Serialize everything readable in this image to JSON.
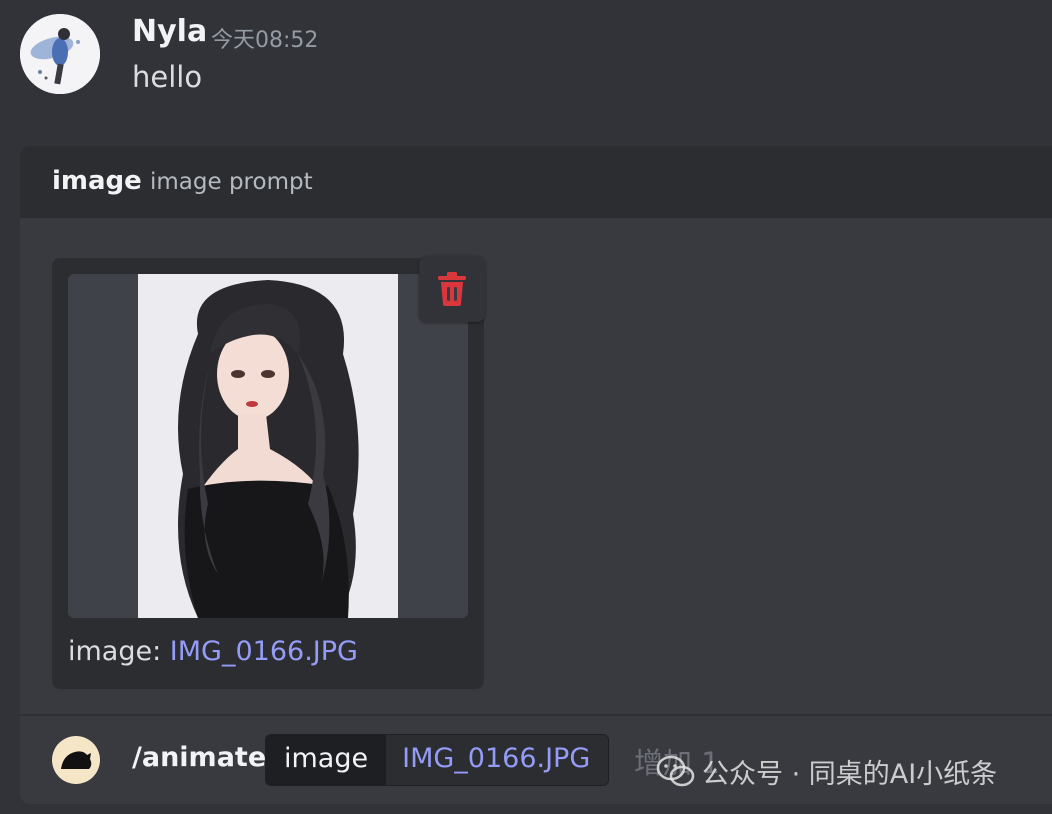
{
  "message": {
    "username": "Nyla",
    "timestamp": "今天08:52",
    "text": "hello"
  },
  "command": {
    "name": "image",
    "description": "image prompt",
    "upload": {
      "label": "image:",
      "filename": "IMG_0166.JPG"
    },
    "input": {
      "slash": "/animate",
      "option_name": "image",
      "option_value": "IMG_0166.JPG",
      "trailing_text": "增加 1"
    }
  },
  "watermark": {
    "text": "公众号 · 同桌的AI小纸条"
  },
  "colors": {
    "background": "#313338",
    "panel": "#383a40",
    "header": "#2b2d31",
    "link": "#949cf7",
    "delete": "#da373c"
  },
  "icons": [
    "avatar",
    "trash-icon",
    "bot-avatar-icon",
    "wechat-icon"
  ]
}
